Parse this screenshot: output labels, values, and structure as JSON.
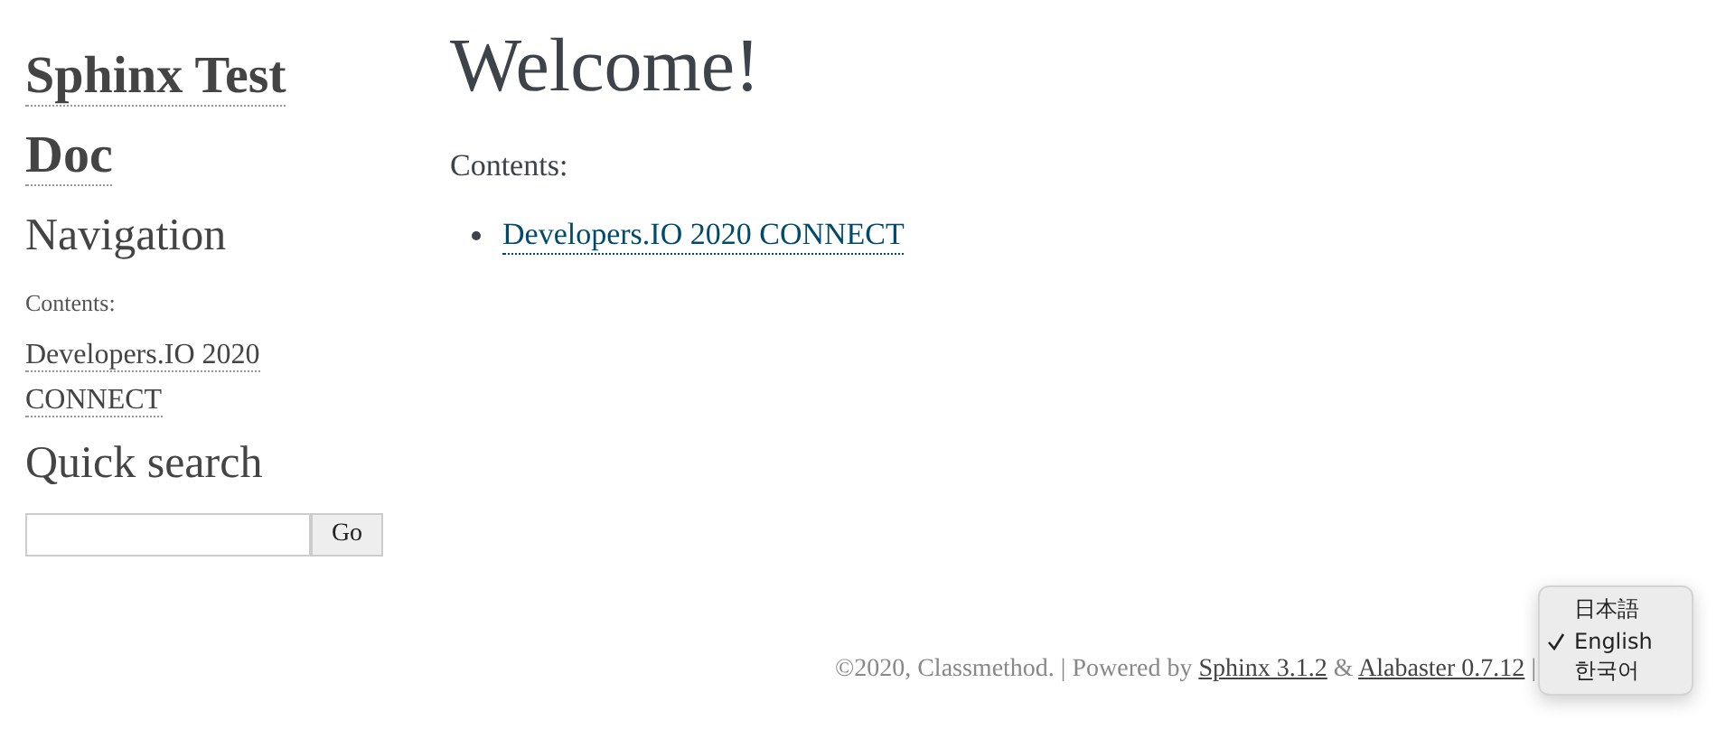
{
  "sidebar": {
    "logo": "Sphinx Test Doc",
    "navigation_heading": "Navigation",
    "contents_caption": "Contents:",
    "nav_links": [
      "Developers.IO 2020 CONNECT"
    ],
    "search_heading": "Quick search",
    "search_button": "Go"
  },
  "main": {
    "title": "Welcome!",
    "contents_caption": "Contents:",
    "toc": [
      "Developers.IO 2020 CONNECT"
    ]
  },
  "footer": {
    "parts": [
      {
        "kind": "text",
        "text": "©2020, Classmethod. | Powered by "
      },
      {
        "kind": "link",
        "text": "Sphinx 3.1.2"
      },
      {
        "kind": "text",
        "text": " & "
      },
      {
        "kind": "link",
        "text": "Alabaster 0.7.12"
      },
      {
        "kind": "text",
        "text": " |"
      }
    ]
  },
  "language_menu": {
    "items": [
      {
        "label": "日本語",
        "selected": false
      },
      {
        "label": "English",
        "selected": true
      },
      {
        "label": "한국어",
        "selected": false
      }
    ]
  }
}
